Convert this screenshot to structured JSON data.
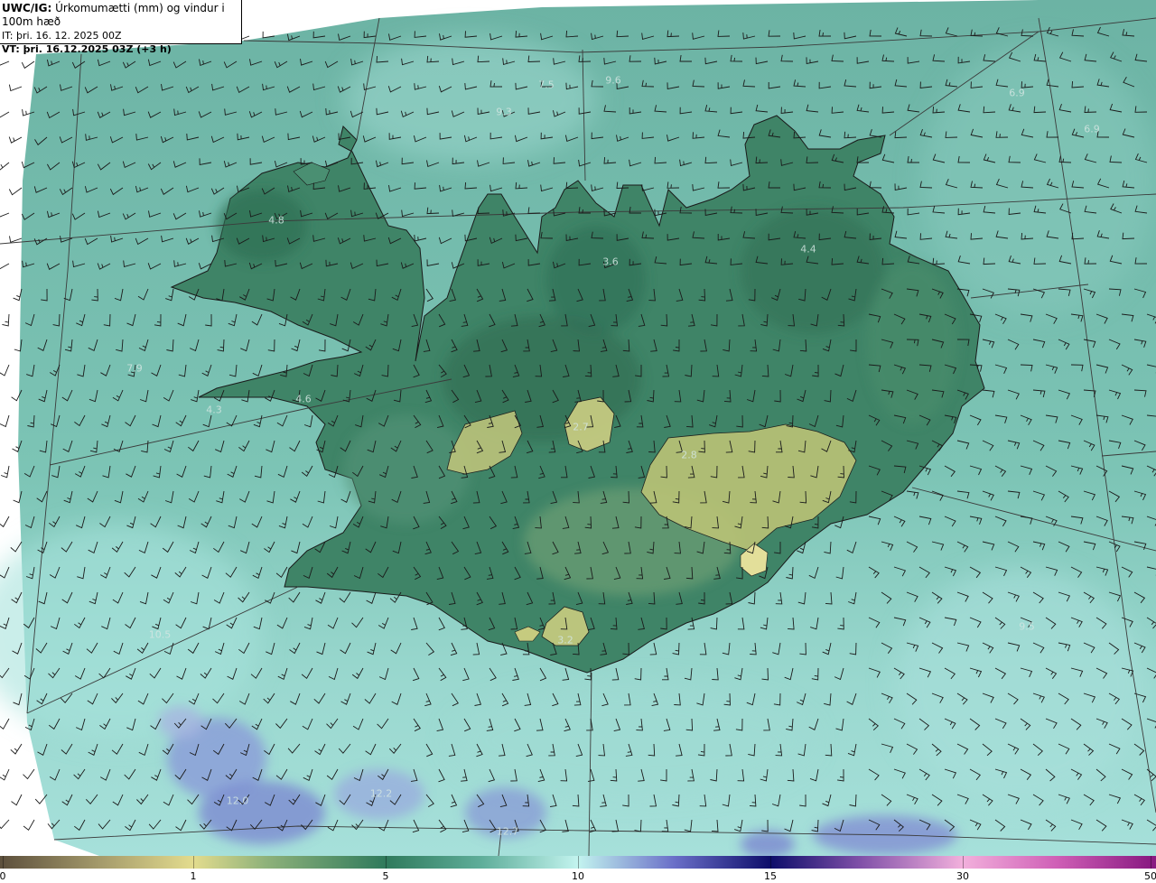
{
  "title": {
    "prefix": "UWC/IG:",
    "description": "Úrkomumætti (mm) og vindur i 100m hæð",
    "it_line": "IT: þri. 16. 12. 2025 00Z",
    "vt_line": "VT: þri. 16.12.2025 03Z (+3 h)"
  },
  "colorbar": {
    "ticks": [
      {
        "label": "0",
        "value": 0
      },
      {
        "label": "1",
        "value": 1
      },
      {
        "label": "5",
        "value": 5
      },
      {
        "label": "10",
        "value": 10
      },
      {
        "label": "15",
        "value": 15
      },
      {
        "label": "30",
        "value": 30
      },
      {
        "label": "50",
        "value": 50
      }
    ],
    "colors": [
      "#6b5d45",
      "#c9c07a",
      "#e8e08a",
      "#2d7a5e",
      "#bff2ee",
      "#10106e",
      "#f0a8d8",
      "#8a1a82"
    ]
  },
  "map_labels": [
    {
      "text": "4.8",
      "place": "vestfirdir"
    },
    {
      "text": "3.6",
      "place": "trollaskagi"
    },
    {
      "text": "4.4",
      "place": "austurland-nordur"
    },
    {
      "text": "7.5",
      "place": "nordan-haf"
    },
    {
      "text": "9.6",
      "place": "nordan-haf-austur"
    },
    {
      "text": "9.3",
      "place": "nordan-haf-sudur"
    },
    {
      "text": "6.9",
      "place": "nordaustan-haf"
    },
    {
      "text": "6.9",
      "place": "austan-haf"
    },
    {
      "text": "7.9",
      "place": "vestan-haf"
    },
    {
      "text": "4.3",
      "place": "snaefellsnes"
    },
    {
      "text": "4.6",
      "place": "borgarfjordur"
    },
    {
      "text": "2.7",
      "place": "hofsjokull"
    },
    {
      "text": "2.8",
      "place": "vatnajokull"
    },
    {
      "text": "3.2",
      "place": "myrdalsjokull"
    },
    {
      "text": "10.5",
      "place": "sudvestan-haf"
    },
    {
      "text": "9.5",
      "place": "sudaustan-haf"
    },
    {
      "text": "12.0",
      "place": "sunnan-haf-vestur"
    },
    {
      "text": "12.2",
      "place": "sunnan-haf"
    },
    {
      "text": "12.7",
      "place": "sunnan-haf-sudur"
    }
  ]
}
